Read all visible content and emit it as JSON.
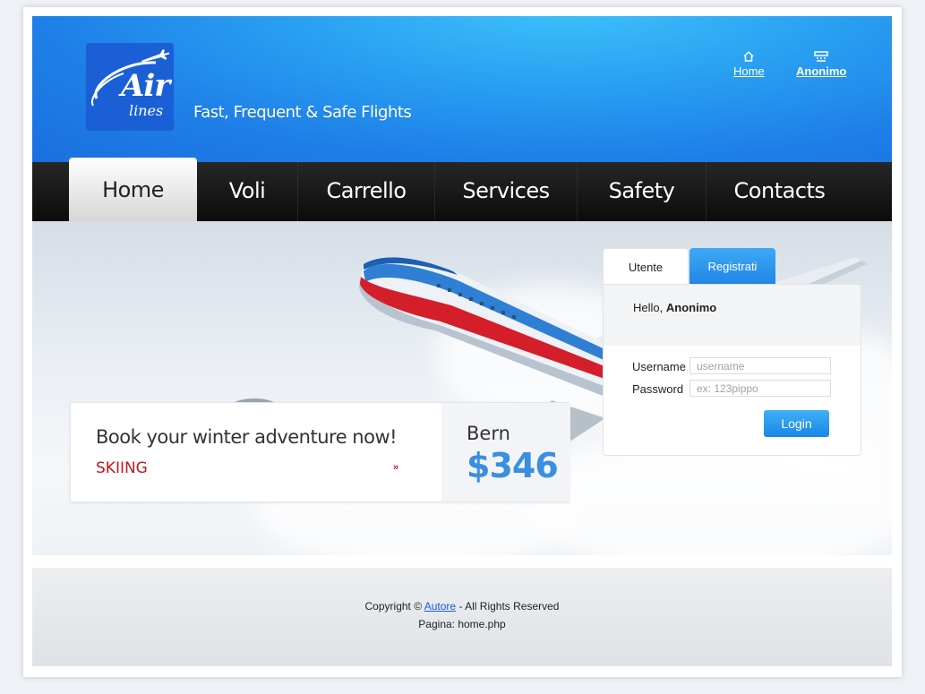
{
  "brand": {
    "logo_text_main": "Air",
    "logo_text_sub": "lines",
    "tagline": "Fast, Frequent & Safe Flights"
  },
  "top_links": {
    "home": {
      "label": "Home",
      "icon": "house-icon"
    },
    "user": {
      "label": "Anonimo",
      "icon": "user-card-icon"
    }
  },
  "nav": {
    "items": [
      {
        "label": "Home",
        "active": true
      },
      {
        "label": "Voli"
      },
      {
        "label": "Carrello"
      },
      {
        "label": "Services"
      },
      {
        "label": "Safety"
      },
      {
        "label": "Contacts"
      }
    ]
  },
  "promo": {
    "title": "Book your winter adventure now!",
    "subtitle": "SKIING",
    "arrow": "»",
    "city": "Bern",
    "price": "$346"
  },
  "login": {
    "tabs": [
      {
        "label": "Utente"
      },
      {
        "label": "Registrati"
      }
    ],
    "hello_prefix": "Hello,",
    "hello_name": "Anonimo",
    "username_label": "Username",
    "username_placeholder": "username",
    "password_label": "Password",
    "password_placeholder": "ex: 123pippo",
    "login_button": "Login"
  },
  "footer": {
    "copyright_prefix": "Copyright ©",
    "author_link": "Autore",
    "copyright_suffix": "- All Rights Reserved",
    "page_label": "Pagina: home.php"
  },
  "colors": {
    "header_blue": "#1e7fe8",
    "accent_blue": "#3a8fe0",
    "promo_red": "#c4161c",
    "nav_dark": "#111111"
  }
}
